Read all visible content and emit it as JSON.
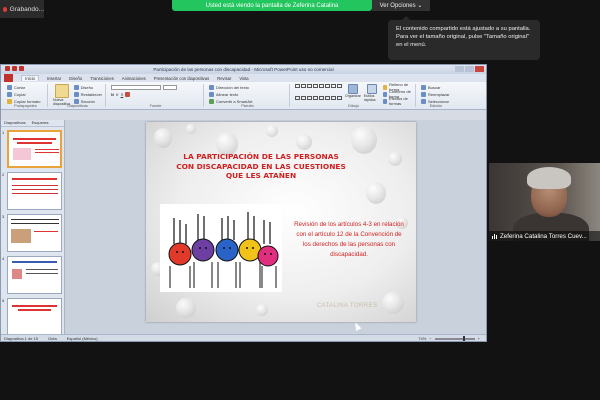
{
  "zoom": {
    "recording_label": "Grabando...",
    "share_banner": "Usted está viendo la pantalla de Zeferina Catalina",
    "view_options_label": "Ver Opciones",
    "tooltip_text": "El contenido compartido está ajustado a su pantalla. Para ver el tamaño original, pulse \"Tamaño original\" en el menú.",
    "participant_name": "Zeferina Catalina Torres Cuev..."
  },
  "powerpoint": {
    "window_title": "Participación de las personas con discapacidad - Microsoft PowerPoint uso no comercial",
    "menu": [
      "Inicio",
      "Insertar",
      "Diseño",
      "Transiciones",
      "Animaciones",
      "Presentación con diapositivas",
      "Revisar",
      "Vista"
    ],
    "ribbon": {
      "clipboard": {
        "cut": "Cortar",
        "copy": "Copiar",
        "format": "Copiar formato",
        "label": "Portapapeles"
      },
      "slides": {
        "new": "Nueva diapositiva",
        "design": "Diseño",
        "reset": "Restablecer",
        "section": "Sección",
        "label": "Diapositivas"
      },
      "font_label": "Fuente",
      "paragraph": {
        "direction": "Dirección del texto",
        "align": "Alinear texto",
        "smartart": "Convertir a SmartArt",
        "label": "Párrafo"
      },
      "drawing": {
        "arrange": "Organizar",
        "styles": "Estilos rápidos",
        "fill": "Relleno de forma",
        "outline": "Contorno de forma",
        "effects": "Efectos de formas",
        "label": "Dibujo"
      },
      "editing": {
        "find": "Buscar",
        "replace": "Reemplazar",
        "select": "Seleccionar",
        "label": "Edición"
      }
    },
    "panel_tabs": [
      "Diapositivas",
      "Esquema"
    ],
    "thumbnail_numbers": [
      "1",
      "2",
      "3",
      "4",
      "5"
    ],
    "slide": {
      "title": "LA PARTICIPACIÓN DE LAS PERSONAS CON DISCAPACIDAD EN LAS CUESTIONES QUE LES ATAÑEN",
      "subtitle": "Revisión de los artículos 4-3 en relación con el artículo 12 de la Convención de los derechos de las personas con discapacidad.",
      "author": "CATALINA TORRES"
    },
    "status": {
      "slide_count": "Diapositiva 1 de 15",
      "theme": "Gota",
      "language": "Español (México)",
      "zoom_percent": "74%"
    }
  }
}
